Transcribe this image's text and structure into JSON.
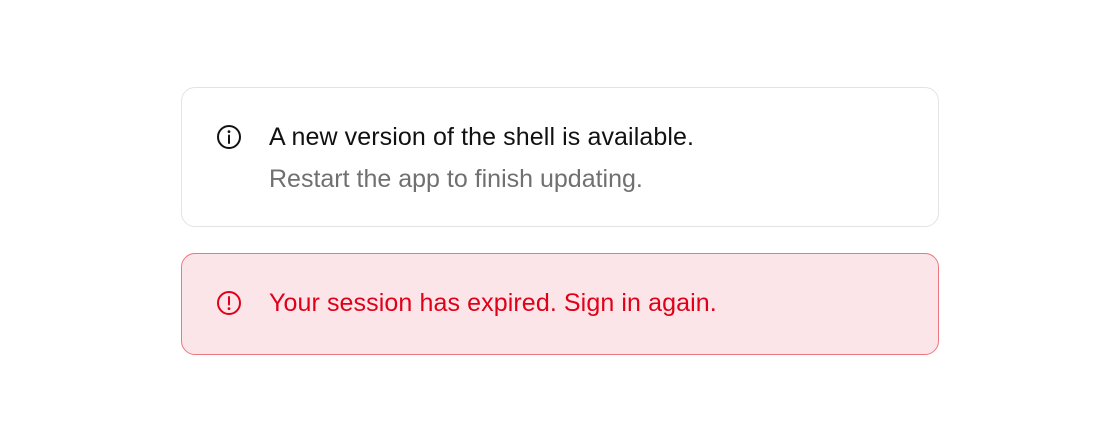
{
  "alerts": {
    "info": {
      "icon": "info-circle-icon",
      "title": "A new version of the shell is available.",
      "description": "Restart the app to finish updating.",
      "colors": {
        "border": "#e3e3e3",
        "background": "#ffffff",
        "title": "#111111",
        "description": "#707070",
        "icon": "#111111"
      }
    },
    "error": {
      "icon": "alert-circle-icon",
      "title": "Your session has expired. Sign in again.",
      "colors": {
        "border": "#ee7680",
        "background": "#fce5e8",
        "title": "#e00019",
        "icon": "#e00019"
      }
    }
  }
}
